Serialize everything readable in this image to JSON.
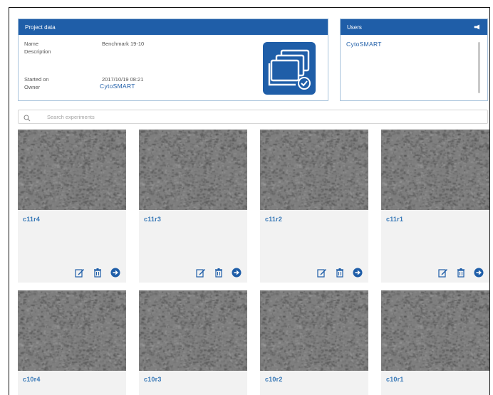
{
  "project_panel": {
    "header": "Project data",
    "fields": {
      "name_label": "Name",
      "name_value": "Benchmark 19-10",
      "description_label": "Description",
      "description_value": "",
      "started_label": "Started on",
      "started_value": "2017/10/19 08:21",
      "owner_label": "Owner",
      "owner_value": "CytoSMART"
    }
  },
  "users_panel": {
    "header": "Users",
    "users": [
      "CytoSMART"
    ]
  },
  "search": {
    "placeholder": "Search experiments",
    "value": ""
  },
  "experiments": [
    {
      "name": "c11r4"
    },
    {
      "name": "c11r3"
    },
    {
      "name": "c11r2"
    },
    {
      "name": "c11r1"
    },
    {
      "name": "c10r4"
    },
    {
      "name": "c10r3"
    },
    {
      "name": "c10r2"
    },
    {
      "name": "c10r1"
    }
  ],
  "colors": {
    "header_blue": "#1f5ea8",
    "link_blue": "#3778b7",
    "card_bg": "#f2f2f2"
  },
  "icons": {
    "header_action": "share-icon",
    "logo": "stacked-images-check-icon",
    "search": "search-icon",
    "card_actions": [
      "edit-icon",
      "trash-icon",
      "arrow-right-circle-icon"
    ]
  }
}
